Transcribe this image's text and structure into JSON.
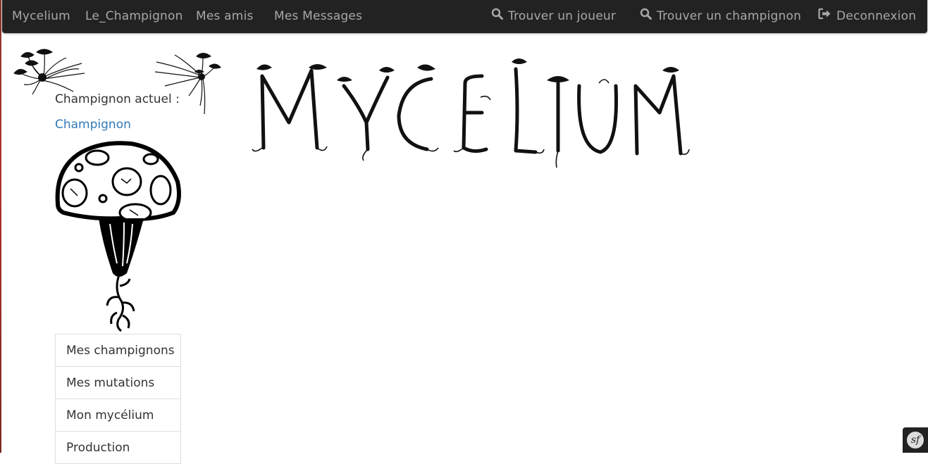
{
  "navbar": {
    "brand": "Mycelium",
    "left_links": [
      "Le_Champignon",
      "Mes amis",
      "Mes Messages"
    ],
    "find_player": "Trouver un joueur",
    "find_mushroom": "Trouver un champignon",
    "logout": "Deconnexion",
    "search_icon": "search-icon",
    "logout_icon": "sign-out-icon"
  },
  "sidebar": {
    "current_label": "Champignon actuel :",
    "current_mushroom": "Champignon",
    "menu": [
      "Mes champignons",
      "Mes mutations",
      "Mon mycélium",
      "Production"
    ]
  },
  "logo": {
    "text": "MYCELIUM"
  },
  "debug_badge": {
    "text": "sf"
  },
  "colors": {
    "navbar_bg": "#222222",
    "nav_text": "#a8a8a8",
    "link": "#337ab7"
  }
}
